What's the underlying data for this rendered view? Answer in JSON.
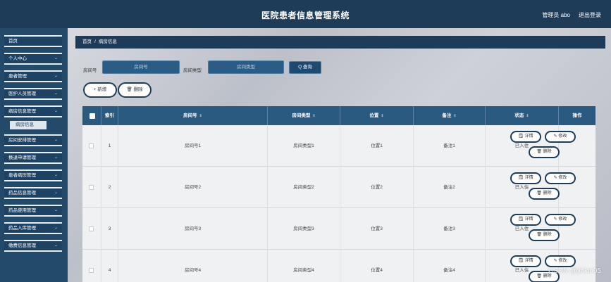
{
  "header": {
    "title": "医院患者信息管理系统",
    "user": "管理员 abo",
    "logout": "退出登录"
  },
  "sidebar": {
    "items": [
      {
        "label": "首页",
        "chevron": ""
      },
      {
        "label": "个人中心",
        "chevron": "⌄"
      },
      {
        "label": "患者管理",
        "chevron": "⌄"
      },
      {
        "label": "医护人员管理",
        "chevron": "⌄"
      },
      {
        "label": "病房信息管理",
        "chevron": "⌄"
      },
      {
        "label": "房间安排管理",
        "chevron": "⌄"
      },
      {
        "label": "换退申请管理",
        "chevron": "⌄"
      },
      {
        "label": "患者病历管理",
        "chevron": "⌄"
      },
      {
        "label": "药品信息管理",
        "chevron": "⌄"
      },
      {
        "label": "药品使用管理",
        "chevron": "⌄"
      },
      {
        "label": "药品入库管理",
        "chevron": "⌄"
      },
      {
        "label": "缴费信息管理",
        "chevron": "⌄"
      }
    ],
    "active_sub": "病房信息"
  },
  "breadcrumb": {
    "home": "首页",
    "separator": "/",
    "current": "病房信息"
  },
  "search": {
    "room_no_label": "房间号",
    "room_no_placeholder": "房间号",
    "room_type_label": "房间类型",
    "room_type_placeholder": "房间类型",
    "query_label": "Q 查询"
  },
  "actions": {
    "add_label": "+ 新增",
    "delete_label": "🗑 删除"
  },
  "table": {
    "headers": {
      "index": "索引",
      "room_no": "房间号",
      "room_type": "房间类型",
      "position": "位置",
      "note": "备注",
      "status": "状态",
      "operation": "操作"
    },
    "sort_icon": "⇕",
    "buttons": {
      "detail": "详情",
      "edit": "修改",
      "delete": "删除"
    },
    "rows": [
      {
        "index": "1",
        "room_no": "房间号1",
        "room_type": "房间类型1",
        "position": "位置1",
        "note": "备注1",
        "status": "已入住"
      },
      {
        "index": "2",
        "room_no": "房间号2",
        "room_type": "房间类型2",
        "position": "位置2",
        "note": "备注2",
        "status": "已入住"
      },
      {
        "index": "3",
        "room_no": "房间号3",
        "room_type": "房间类型3",
        "position": "位置3",
        "note": "备注3",
        "status": "已入住"
      },
      {
        "index": "4",
        "room_no": "房间号4",
        "room_type": "房间类型4",
        "position": "位置4",
        "note": "备注4",
        "status": "已入住"
      }
    ]
  },
  "watermark": "CSDN @jinkin05",
  "colors": {
    "header_bg": "#1e3c58",
    "sidebar_bg": "#244a6b",
    "table_header": "#2b5a80",
    "accent": "#1e3c58"
  }
}
